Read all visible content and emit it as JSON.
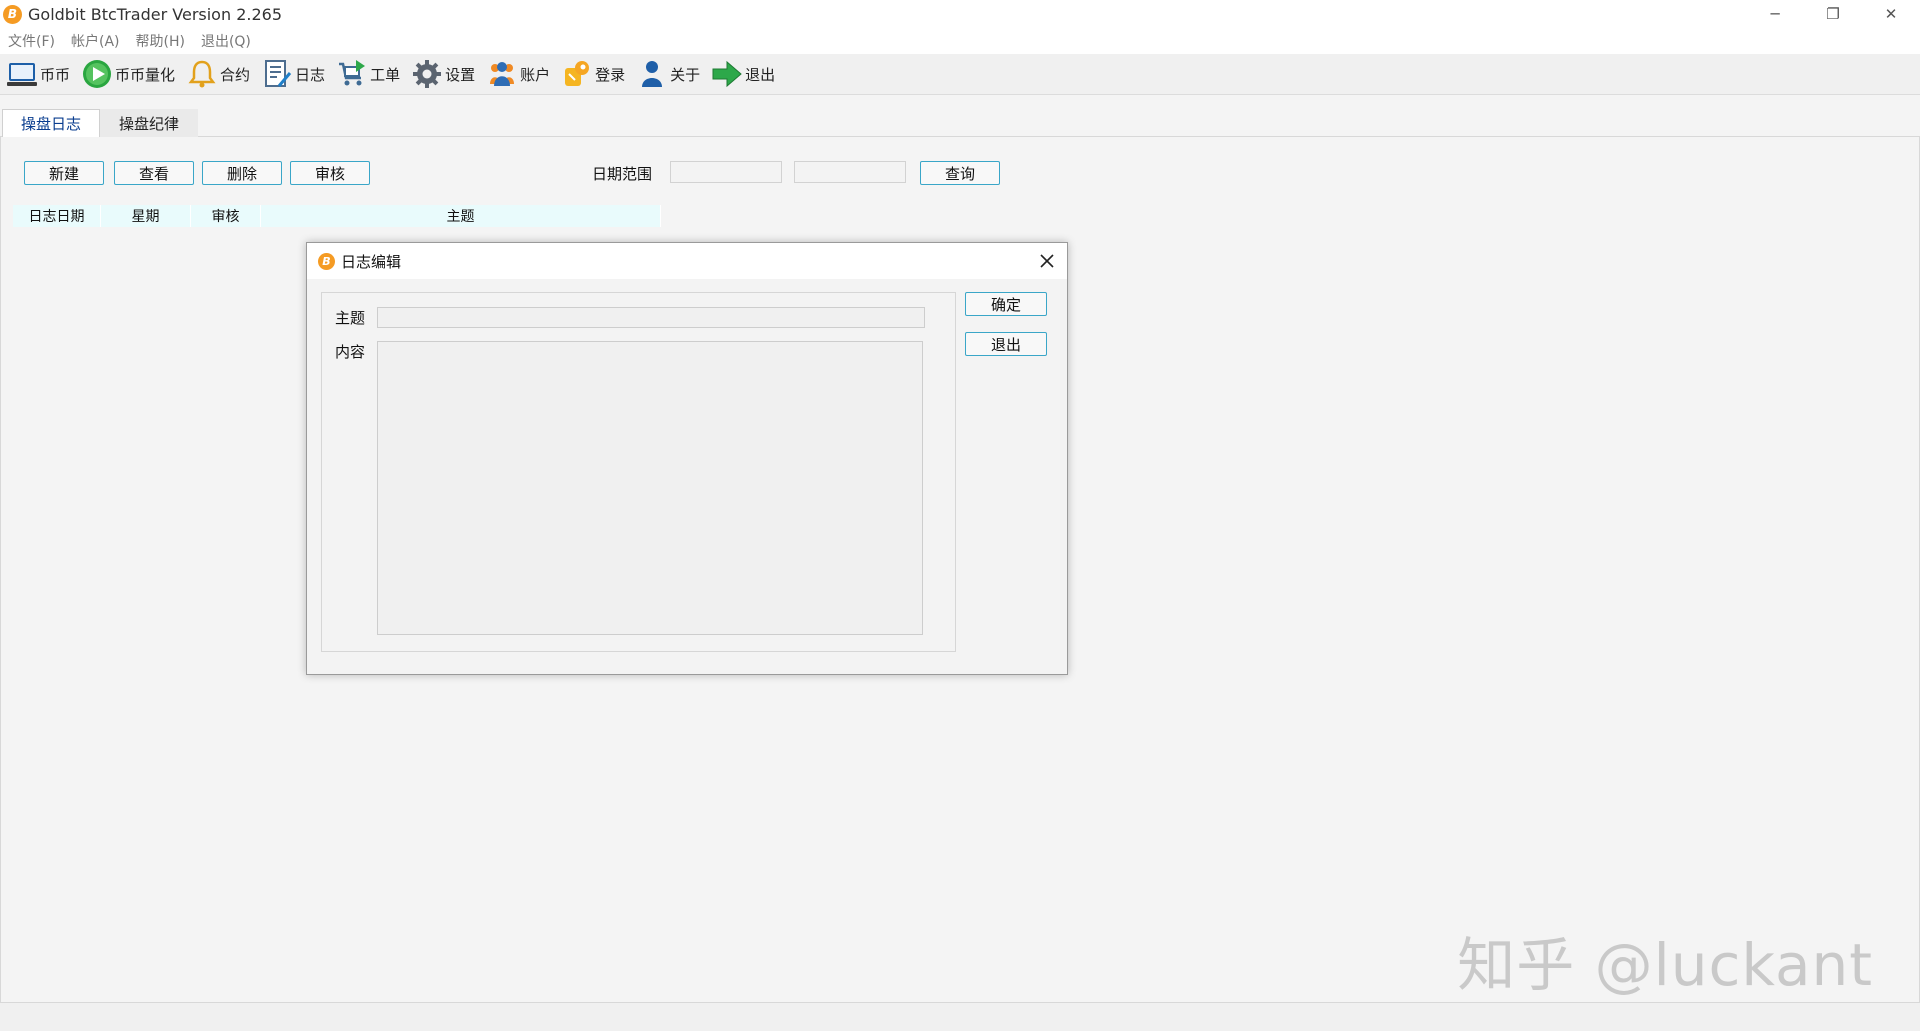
{
  "window": {
    "title": "Goldbit BtcTrader Version 2.265",
    "logo_glyph": "B",
    "minimize_glyph": "─",
    "restore_glyph": "❐",
    "close_glyph": "✕"
  },
  "menu": [
    {
      "label": "文件(F)"
    },
    {
      "label": "帐户(A)"
    },
    {
      "label": "帮助(H)"
    },
    {
      "label": "退出(Q)"
    }
  ],
  "toolbar": [
    {
      "label": "币币",
      "icon": "monitor-icon"
    },
    {
      "label": "币币量化",
      "icon": "play-circle-icon"
    },
    {
      "label": "合约",
      "icon": "bell-icon"
    },
    {
      "label": "日志",
      "icon": "notepad-icon"
    },
    {
      "label": "工单",
      "icon": "cart-icon"
    },
    {
      "label": "设置",
      "icon": "gear-icon"
    },
    {
      "label": "账户",
      "icon": "users-icon"
    },
    {
      "label": "登录",
      "icon": "key-icon"
    },
    {
      "label": "关于",
      "icon": "person-icon"
    },
    {
      "label": "退出",
      "icon": "exit-arrow-icon"
    }
  ],
  "tabs": [
    {
      "label": "操盘日志",
      "active": true
    },
    {
      "label": "操盘纪律",
      "active": false
    }
  ],
  "actions": {
    "new_label": "新建",
    "view_label": "查看",
    "delete_label": "删除",
    "review_label": "审核",
    "date_range_label": "日期范围",
    "date_from": "",
    "date_to": "",
    "query_label": "查询"
  },
  "grid": {
    "columns": [
      "日志日期",
      "星期",
      "审核",
      "主题"
    ],
    "rows": []
  },
  "dialog": {
    "title": "日志编辑",
    "subject_label": "主题",
    "content_label": "内容",
    "subject_value": "",
    "content_value": "",
    "ok_label": "确定",
    "exit_label": "退出"
  },
  "watermark": "知乎 @luckant",
  "colors": {
    "accent_border": "#3aa6c8",
    "brand_orange": "#f59b23",
    "grid_header_bg": "#e9fbfc",
    "active_tab_text": "#0a3d8f"
  }
}
